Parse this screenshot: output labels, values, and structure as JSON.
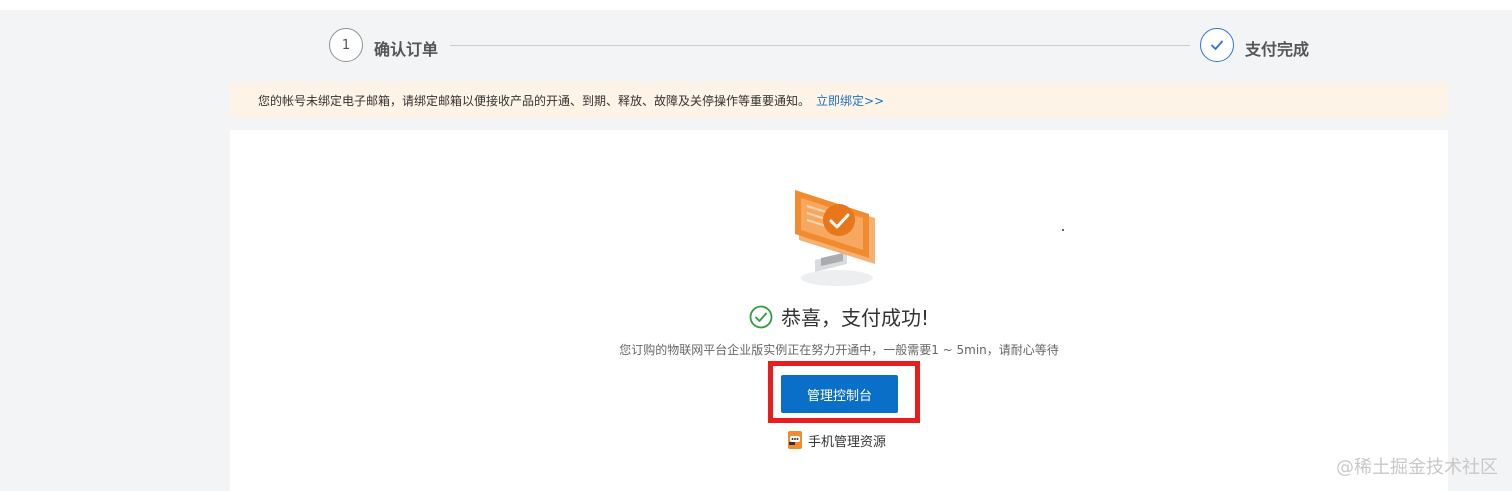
{
  "steps": [
    {
      "number": "1",
      "label": "确认订单",
      "state": "done"
    },
    {
      "label": "支付完成",
      "state": "current"
    }
  ],
  "notice": {
    "text": "您的帐号未绑定电子邮箱，请绑定邮箱以便接收产品的开通、到期、释放、故障及关停操作等重要通知。",
    "link": "立即绑定>>"
  },
  "result": {
    "title": "恭喜，支付成功!",
    "subtitle": "您订购的物联网平台企业版实例正在努力开通中，一般需要1 ~ 5min，请耐心等待",
    "primary_button": "管理控制台",
    "mobile_link": "手机管理资源"
  },
  "watermark": "@稀土掘金技术社区",
  "colors": {
    "accent": "#0a6fc7",
    "success": "#2e9e3f",
    "notice_bg": "#fdf3e6",
    "highlight": "#e81d1d",
    "illustration_orange": "#f28a2e"
  },
  "icons": {
    "success": "check-circle-icon",
    "step_done": "checkmark-icon",
    "mobile": "mobile-phone-icon",
    "illustration": "monitor-success-illustration"
  }
}
